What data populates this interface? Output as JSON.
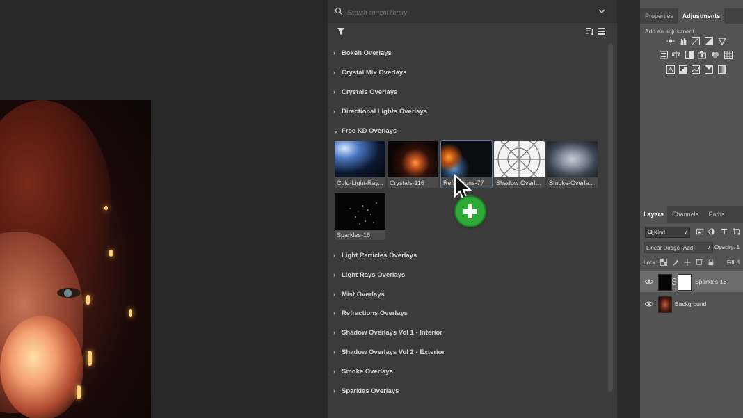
{
  "search": {
    "placeholder": "Search current library"
  },
  "groups_top": [
    {
      "label": "Bokeh Overlays",
      "expanded": false
    },
    {
      "label": "Crystal Mix Overlays",
      "expanded": false
    },
    {
      "label": "Crystals Overlays",
      "expanded": false
    },
    {
      "label": "Directional Lights Overlays",
      "expanded": false
    },
    {
      "label": "Free KD Overlays",
      "expanded": true
    }
  ],
  "free_kd_items": [
    {
      "label": "Cold-Light-Ray...",
      "selected": false
    },
    {
      "label": "Crystals-116",
      "selected": false
    },
    {
      "label": "Refractions-77",
      "selected": true
    },
    {
      "label": "Shadow Overla...",
      "selected": false
    },
    {
      "label": "Smoke-Overla...",
      "selected": false
    },
    {
      "label": "Sparkles-16",
      "selected": false
    }
  ],
  "groups_bottom": [
    {
      "label": "Light Particles Overlays"
    },
    {
      "label": "Light Rays Overlays"
    },
    {
      "label": "Mist Overlays"
    },
    {
      "label": "Refractions Overlays"
    },
    {
      "label": "Shadow Overlays Vol 1 - Interior"
    },
    {
      "label": "Shadow Overlays Vol 2 - Exterior"
    },
    {
      "label": "Smoke Overlays"
    },
    {
      "label": "Sparkles Overlays"
    }
  ],
  "properties_panel": {
    "tabs": [
      "Properties",
      "Adjustments"
    ],
    "active_tab": "Adjustments",
    "add_adjustment": "Add an adjustment"
  },
  "layers_panel": {
    "tabs": [
      "Layers",
      "Channels",
      "Paths"
    ],
    "active_tab": "Layers",
    "kind": "Kind",
    "blend_mode": "Linear Dodge (Add)",
    "opacity_label": "Opacity: 1",
    "lock_label": "Lock:",
    "fill_label": "Fill: 1",
    "layers": [
      {
        "name": "Sparkles-16",
        "selected": true
      },
      {
        "name": "Background",
        "selected": false
      }
    ]
  },
  "colors": {
    "accent_green": "#2ea836",
    "selection_blue": "#5a7fae"
  }
}
